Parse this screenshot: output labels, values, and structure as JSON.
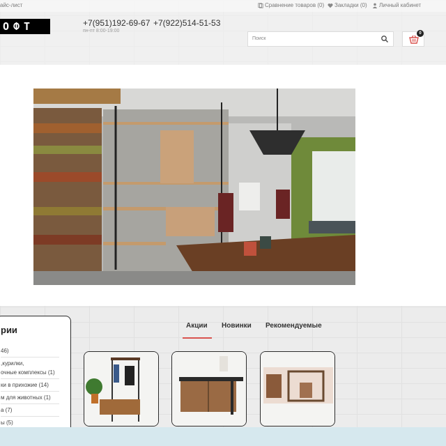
{
  "topbar": {
    "sitemap": "айс-лист",
    "compare": "Сравнение товаров (0)",
    "bookmarks": "Закладки (0)",
    "account": "Личный кабинет"
  },
  "header": {
    "logo": "ОФТ",
    "phone1": "+7(951)192-69-67",
    "phone2": "+7(922)514-51-53",
    "hours": "пн-пт 8:00-19:00",
    "search_placeholder": "Поиск",
    "cart_count": "0"
  },
  "sidebar": {
    "title": "рии",
    "items": [
      "46)",
      ",курилки,",
      "очные комплексы (1)",
      "ки в прихожие (14)",
      "м для животных (1)",
      "а (7)",
      "ы (5)"
    ]
  },
  "tabs": [
    "Акции",
    "Новинки",
    "Рекомендуемые"
  ],
  "colors": {
    "accent": "#d9534f",
    "logo_bg": "#000000",
    "logo_red": "#e1251b",
    "cart_icon": "#d9534f"
  },
  "icons": [
    "compare-icon",
    "heart-icon",
    "user-icon",
    "search-icon",
    "cart-icon"
  ]
}
